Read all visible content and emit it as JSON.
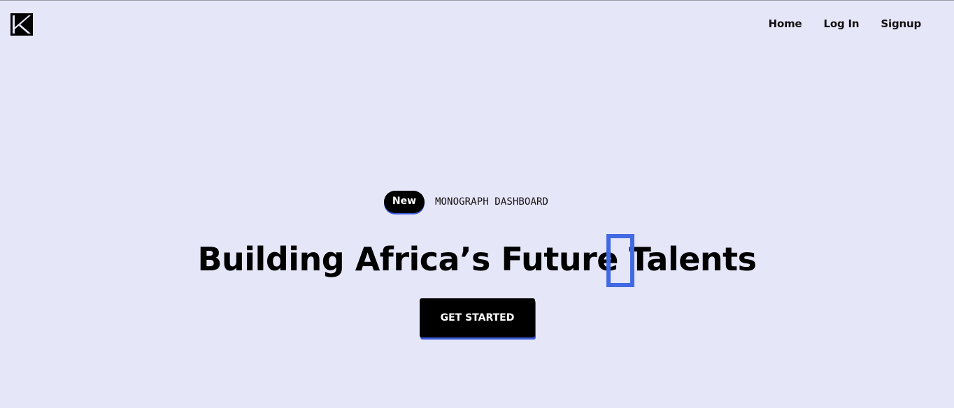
{
  "brand": {
    "logo_icon": "k-logo-icon",
    "logo_color": "#000000"
  },
  "nav": {
    "items": [
      {
        "label": "Home"
      },
      {
        "label": "Log In"
      },
      {
        "label": "Signup"
      }
    ]
  },
  "hero": {
    "badge": "New",
    "badge_label": "MONOGRAPH DASHBOARD",
    "headline": "Building Africa’s Future Talents",
    "cta_label": "GET STARTED"
  },
  "colors": {
    "background": "#e6e6f9",
    "accent": "#3b5bdb",
    "cursor_highlight": "#4169e1",
    "button_bg": "#000000",
    "button_text": "#ffffff"
  }
}
